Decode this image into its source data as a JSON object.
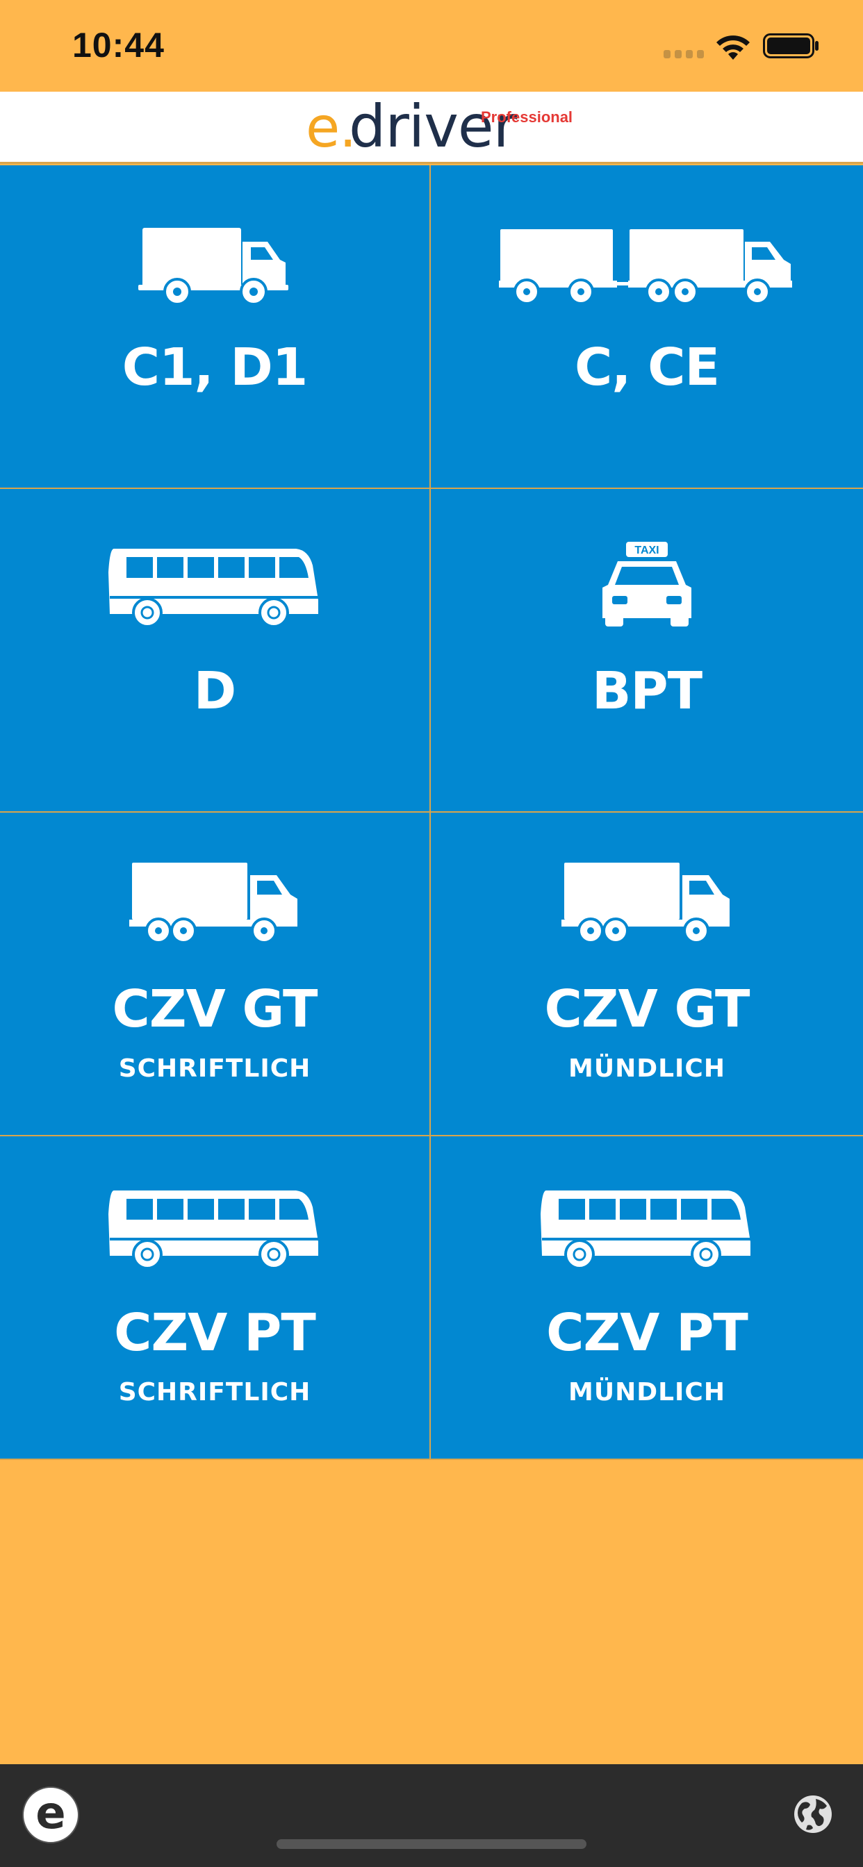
{
  "status_bar": {
    "time": "10:44"
  },
  "header": {
    "logo_e": "e",
    "logo_dot": ".",
    "logo_driver": "driver",
    "logo_badge": "Professional",
    "colors": {
      "e": "#F5A623",
      "driver": "#1F2F4A",
      "badge": "#E53935"
    }
  },
  "tiles": [
    {
      "title": "C1, D1",
      "subtitle": "",
      "icon": "small-truck-icon"
    },
    {
      "title": "C, CE",
      "subtitle": "",
      "icon": "truck-trailer-icon"
    },
    {
      "title": "D",
      "subtitle": "",
      "icon": "bus-icon"
    },
    {
      "title": "BPT",
      "subtitle": "",
      "icon": "taxi-icon"
    },
    {
      "title": "CZV GT",
      "subtitle": "SCHRIFTLICH",
      "icon": "truck-icon"
    },
    {
      "title": "CZV GT",
      "subtitle": "MÜNDLICH",
      "icon": "truck-icon"
    },
    {
      "title": "CZV PT",
      "subtitle": "SCHRIFTLICH",
      "icon": "bus-icon"
    },
    {
      "title": "CZV PT",
      "subtitle": "MÜNDLICH",
      "icon": "bus-icon"
    }
  ],
  "taxi_sign": "TAXI",
  "bottom_bar": {
    "e_logo": "e",
    "globe_icon": "globe-icon"
  },
  "colors": {
    "background": "#FFB74D",
    "tile": "#0288D1",
    "bottom_bar": "#2C2C2C"
  }
}
